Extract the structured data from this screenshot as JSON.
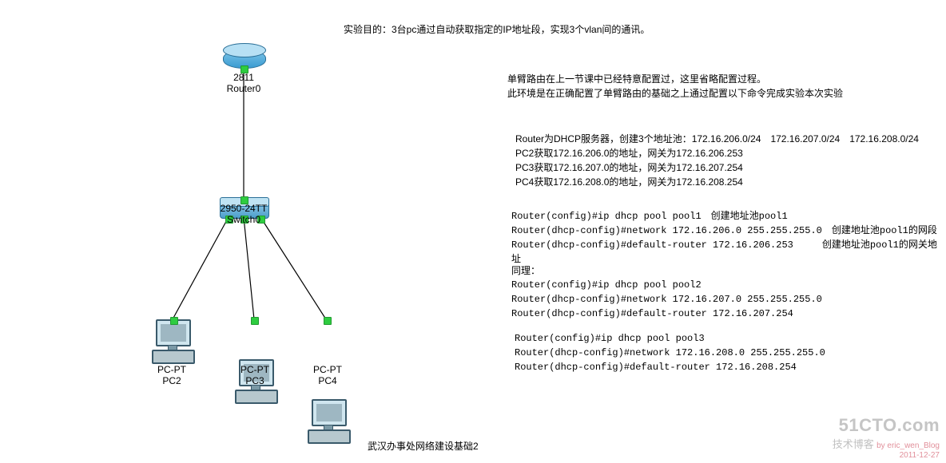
{
  "title": "实验目的：3台pc通过自动获取指定的IP地址段，实现3个vlan间的通讯。",
  "footer": "武汉办事处网络建设基础2",
  "devices": {
    "router": {
      "model": "2811",
      "name": "Router0"
    },
    "switch": {
      "model": "2950-24TT",
      "name": "Switch0"
    },
    "pc2": {
      "type": "PC-PT",
      "name": "PC2"
    },
    "pc3": {
      "type": "PC-PT",
      "name": "PC3"
    },
    "pc4": {
      "type": "PC-PT",
      "name": "PC4"
    }
  },
  "notes": {
    "intro_line1": "单臂路由在上一节课中已经特意配置过，这里省略配置过程。",
    "intro_line2": "此环境是在正确配置了单臂路由的基础之上通过配置以下命令完成实验本次实验",
    "desc_line1": "Router为DHCP服务器，创建3个地址池：172.16.206.0/24　172.16.207.0/24　172.16.208.0/24",
    "desc_line2": "PC2获取172.16.206.0的地址，网关为172.16.206.253",
    "desc_line3": "PC3获取172.16.207.0的地址，网关为172.16.207.254",
    "desc_line4": "PC4获取172.16.208.0的地址，网关为172.16.208.254",
    "cfg1_line1": "Router(config)#ip dhcp pool pool1　创建地址池pool1",
    "cfg1_line2": "Router(dhcp-config)#network 172.16.206.0 255.255.255.0　创建地址池pool1的网段",
    "cfg1_line3": "Router(dhcp-config)#default-router 172.16.206.253　　　创建地址池pool1的网关地址",
    "cfg2_header": "同理：",
    "cfg2_line1": "Router(config)#ip dhcp pool pool2",
    "cfg2_line2": "Router(dhcp-config)#network 172.16.207.0 255.255.255.0",
    "cfg2_line3": "Router(dhcp-config)#default-router 172.16.207.254",
    "cfg3_line1": "Router(config)#ip dhcp pool pool3",
    "cfg3_line2": "Router(dhcp-config)#network 172.16.208.0 255.255.255.0",
    "cfg3_line3": "Router(dhcp-config)#default-router 172.16.208.254"
  },
  "watermark": {
    "site": "51CTO.com",
    "tagline": "技术博客",
    "byline": "by eric_wen_Blog",
    "date": "2011-12-27"
  }
}
